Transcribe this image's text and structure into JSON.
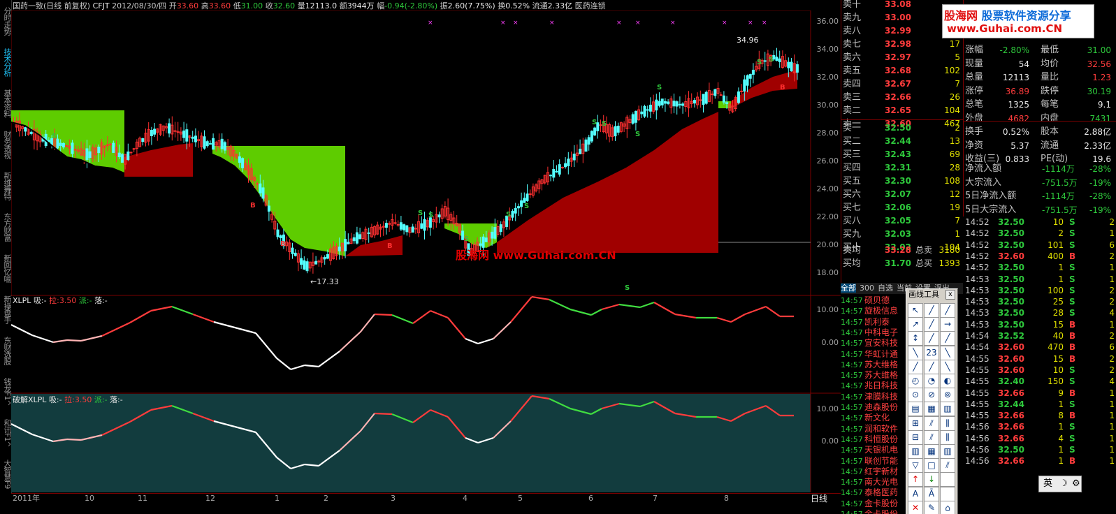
{
  "left_tabs": [
    {
      "label": "分时走势",
      "active": false
    },
    {
      "label": "技术分析",
      "active": true
    },
    {
      "label": "基本资料",
      "active": false
    },
    {
      "label": "财务透视",
      "active": false
    },
    {
      "label": "新维舞特",
      "active": false
    },
    {
      "label": "东方财富",
      "active": false
    },
    {
      "label": "新回忆喻",
      "active": false
    },
    {
      "label": "新操盘手",
      "active": false
    },
    {
      "label": "东财选股",
      "active": false
    },
    {
      "label": "钱龙F1^",
      "active": false
    },
    {
      "label": "和讯F1^",
      "active": false
    },
    {
      "label": "大智慧F9",
      "active": false
    }
  ],
  "header": {
    "name": "国药一致(日线 前复权)",
    "code": "CFJT",
    "date": "2012/08/30/四",
    "open_label": "开",
    "open": "33.60",
    "high_label": "高",
    "high": "33.60",
    "low_label": "低",
    "low": "31.00",
    "close_label": "收",
    "close": "32.60",
    "vol_label": "量",
    "vol": "12113.0",
    "amt_label": "额",
    "amt": "3944万",
    "chg_label": "幅",
    "chg": "-0.94(-2.80%)",
    "amp_label": "振",
    "amp": "2.60(7.75%)",
    "turn_label": "换",
    "turn": "0.52%",
    "float_label": "流通",
    "float": "2.33亿",
    "sector": "医药连锁"
  },
  "main_axis": [
    "36.00",
    "34.00",
    "32.00",
    "30.00",
    "28.00",
    "26.00",
    "24.00",
    "22.00",
    "20.00",
    "18.00"
  ],
  "annotations": {
    "high_mark": "34.96",
    "low_mark": "←17.33",
    "watermark": "股海网 www.Guhai.com.CN",
    "buy": "B",
    "sell": "S"
  },
  "ind1": {
    "name": "XLPL",
    "x_label": "吸:",
    "x_val": "-",
    "l_label": "拉:",
    "l_val": "3.50",
    "p_label": "派:",
    "p_val": "-",
    "d_label": "落:",
    "d_val": "-",
    "axis": [
      "10.00",
      "0.00"
    ]
  },
  "ind2": {
    "name": "破解XLPL",
    "x_label": "吸:",
    "x_val": "-",
    "l_label": "拉:",
    "l_val": "3.50",
    "p_label": "派:",
    "p_val": "-",
    "d_label": "落:",
    "d_val": "-",
    "axis": [
      "10.00",
      "0.00"
    ]
  },
  "time_axis": [
    "2011年",
    "10",
    "11",
    "12",
    "1",
    "2",
    "3",
    "4",
    "5",
    "6",
    "7",
    "8"
  ],
  "period": "日线",
  "sell_book": [
    {
      "lab": "卖十",
      "price": "33.08",
      "vol": "-"
    },
    {
      "lab": "卖九",
      "price": "33.00",
      "vol": ""
    },
    {
      "lab": "卖八",
      "price": "32.99",
      "vol": ""
    },
    {
      "lab": "卖七",
      "price": "32.98",
      "vol": "17"
    },
    {
      "lab": "卖六",
      "price": "32.97",
      "vol": "5"
    },
    {
      "lab": "卖五",
      "price": "32.68",
      "vol": "102"
    },
    {
      "lab": "卖四",
      "price": "32.67",
      "vol": "7"
    },
    {
      "lab": "卖三",
      "price": "32.66",
      "vol": "26"
    },
    {
      "lab": "卖二",
      "price": "32.65",
      "vol": "104"
    },
    {
      "lab": "卖一",
      "price": "32.60",
      "vol": "467"
    }
  ],
  "buy_book": [
    {
      "lab": "买一",
      "price": "32.50",
      "vol": "2"
    },
    {
      "lab": "买二",
      "price": "32.44",
      "vol": "13"
    },
    {
      "lab": "买三",
      "price": "32.43",
      "vol": "69"
    },
    {
      "lab": "买四",
      "price": "32.31",
      "vol": "28"
    },
    {
      "lab": "买五",
      "price": "32.30",
      "vol": "108"
    },
    {
      "lab": "买六",
      "price": "32.07",
      "vol": "12"
    },
    {
      "lab": "买七",
      "price": "32.06",
      "vol": "19"
    },
    {
      "lab": "买八",
      "price": "32.05",
      "vol": "7"
    },
    {
      "lab": "买九",
      "price": "32.03",
      "vol": "1"
    },
    {
      "lab": "买十",
      "price": "32.02",
      "vol": "104"
    }
  ],
  "avg": {
    "sell_lab": "卖均",
    "sell": "33.28",
    "tsell_lab": "总卖",
    "tsell": "3180",
    "buy_lab": "买均",
    "buy": "31.70",
    "tbuy_lab": "总买",
    "tbuy": "1393"
  },
  "banner": {
    "brand": "股海网",
    "slogan": "股票软件资源分享",
    "url": "www.Guhai.com.CN"
  },
  "stats": [
    {
      "a": "涨幅",
      "b": "-2.80%",
      "bc": "green",
      "c": "最低",
      "d": "31.00",
      "dc": "green"
    },
    {
      "a": "现量",
      "b": "54",
      "bc": "white",
      "c": "均价",
      "d": "32.56",
      "dc": "red"
    },
    {
      "a": "总量",
      "b": "12113",
      "bc": "white",
      "c": "量比",
      "d": "1.23",
      "dc": "red"
    },
    {
      "a": "涨停",
      "b": "36.89",
      "bc": "red",
      "c": "跌停",
      "d": "30.19",
      "dc": "green"
    },
    {
      "a": "总笔",
      "b": "1325",
      "bc": "white",
      "c": "每笔",
      "d": "9.1",
      "dc": "white"
    },
    {
      "a": "外盘",
      "b": "4682",
      "bc": "red",
      "c": "内盘",
      "d": "7431",
      "dc": "green"
    },
    {
      "a": "换手",
      "b": "0.52%",
      "bc": "white",
      "c": "股本",
      "d": "2.88亿",
      "dc": "white"
    },
    {
      "a": "净资",
      "b": "5.37",
      "bc": "white",
      "c": "流通",
      "d": "2.33亿",
      "dc": "white"
    },
    {
      "a": "收益(三)",
      "b": "0.833",
      "bc": "white",
      "c": "PE(动)",
      "d": "19.6",
      "dc": "white"
    }
  ],
  "flows": [
    {
      "a": "净流入额",
      "b": "-1114万",
      "c": "-28%"
    },
    {
      "a": "大宗流入",
      "b": "-751.5万",
      "c": "-19%"
    },
    {
      "a": "5日净流入额",
      "b": "-1114万",
      "c": "-28%"
    },
    {
      "a": "5日大宗流入",
      "b": "-751.5万",
      "c": "-19%"
    }
  ],
  "ticks": [
    {
      "t": "14:52",
      "p": "32.50",
      "v": "10",
      "s": "S",
      "n": "2"
    },
    {
      "t": "14:52",
      "p": "32.50",
      "v": "2",
      "s": "S",
      "n": "1"
    },
    {
      "t": "14:52",
      "p": "32.50",
      "v": "101",
      "s": "S",
      "n": "6"
    },
    {
      "t": "14:52",
      "p": "32.60",
      "v": "400",
      "s": "B",
      "n": "2"
    },
    {
      "t": "14:52",
      "p": "32.50",
      "v": "1",
      "s": "S",
      "n": "1"
    },
    {
      "t": "14:53",
      "p": "32.50",
      "v": "1",
      "s": "S",
      "n": "1"
    },
    {
      "t": "14:53",
      "p": "32.50",
      "v": "100",
      "s": "S",
      "n": "2"
    },
    {
      "t": "14:53",
      "p": "32.50",
      "v": "25",
      "s": "S",
      "n": "2"
    },
    {
      "t": "14:53",
      "p": "32.50",
      "v": "28",
      "s": "S",
      "n": "4"
    },
    {
      "t": "14:53",
      "p": "32.50",
      "v": "15",
      "s": "B",
      "n": "1"
    },
    {
      "t": "14:54",
      "p": "32.52",
      "v": "40",
      "s": "B",
      "n": "2"
    },
    {
      "t": "14:54",
      "p": "32.60",
      "v": "470",
      "s": "B",
      "n": "6"
    },
    {
      "t": "14:55",
      "p": "32.60",
      "v": "15",
      "s": "B",
      "n": "2"
    },
    {
      "t": "14:55",
      "p": "32.60",
      "v": "10",
      "s": "S",
      "n": "2"
    },
    {
      "t": "14:55",
      "p": "32.40",
      "v": "150",
      "s": "S",
      "n": "4"
    },
    {
      "t": "14:55",
      "p": "32.66",
      "v": "9",
      "s": "B",
      "n": "1"
    },
    {
      "t": "14:55",
      "p": "32.44",
      "v": "1",
      "s": "S",
      "n": "1"
    },
    {
      "t": "14:55",
      "p": "32.66",
      "v": "8",
      "s": "B",
      "n": "1"
    },
    {
      "t": "14:56",
      "p": "32.66",
      "v": "1",
      "s": "S",
      "n": "1"
    },
    {
      "t": "14:56",
      "p": "32.66",
      "v": "4",
      "s": "S",
      "n": "1"
    },
    {
      "t": "14:56",
      "p": "32.50",
      "v": "1",
      "s": "S",
      "n": "1"
    },
    {
      "t": "14:56",
      "p": "32.66",
      "v": "1",
      "s": "B",
      "n": "1"
    }
  ],
  "list_tabs": [
    "全部",
    "300",
    "自选",
    "当前",
    "设置",
    "浮出"
  ],
  "list": [
    {
      "t": "14:57",
      "nm": "硕贝德"
    },
    {
      "t": "14:57",
      "nm": "旋极信息"
    },
    {
      "t": "14:57",
      "nm": "凯利泰"
    },
    {
      "t": "14:57",
      "nm": "中科电子"
    },
    {
      "t": "14:57",
      "nm": "宜安科技"
    },
    {
      "t": "14:57",
      "nm": "华虹计通"
    },
    {
      "t": "14:57",
      "nm": "苏大维格"
    },
    {
      "t": "14:57",
      "nm": "苏大维格"
    },
    {
      "t": "14:57",
      "nm": "兆日科技"
    },
    {
      "t": "14:57",
      "nm": "津膜科技"
    },
    {
      "t": "14:57",
      "nm": "迪森股份"
    },
    {
      "t": "14:57",
      "nm": "新文化"
    },
    {
      "t": "14:57",
      "nm": "润和软件"
    },
    {
      "t": "14:57",
      "nm": "科恒股份"
    },
    {
      "t": "14:57",
      "nm": "天银机电"
    },
    {
      "t": "14:57",
      "nm": "联创节能"
    },
    {
      "t": "14:57",
      "nm": "红宇新材"
    },
    {
      "t": "14:57",
      "nm": "南大光电"
    },
    {
      "t": "14:57",
      "nm": "泰格医药"
    },
    {
      "t": "14:57",
      "nm": "金卡股份"
    },
    {
      "t": "14:57",
      "nm": "金卡股份"
    }
  ],
  "tools": {
    "title": "画线工具",
    "close": "x"
  },
  "ime": "英"
}
